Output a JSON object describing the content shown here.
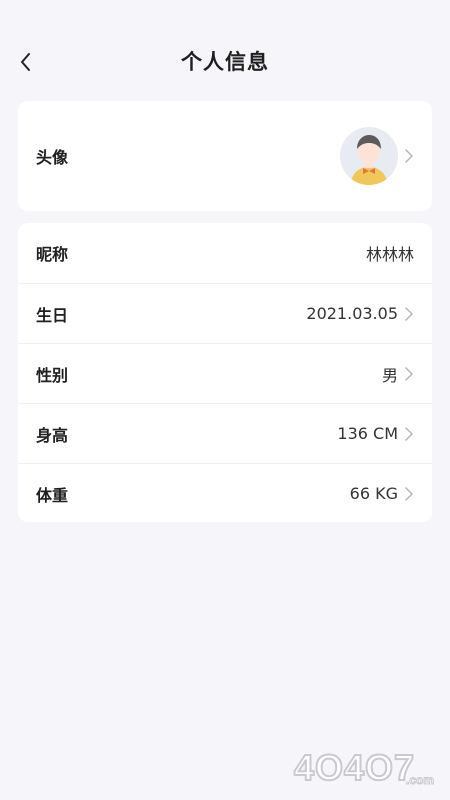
{
  "header": {
    "title": "个人信息",
    "back_icon": "chevron-left-icon"
  },
  "avatar_row": {
    "label": "头像",
    "avatar_icon": "user-avatar-illustration"
  },
  "info_rows": [
    {
      "key": "nickname",
      "label": "昵称",
      "value": "林林林",
      "has_chevron": false
    },
    {
      "key": "birthday",
      "label": "生日",
      "value": "2021.03.05",
      "has_chevron": true
    },
    {
      "key": "gender",
      "label": "性别",
      "value": "男",
      "has_chevron": true
    },
    {
      "key": "height",
      "label": "身高",
      "value": "136 CM",
      "has_chevron": true
    },
    {
      "key": "weight",
      "label": "体重",
      "value": "66 KG",
      "has_chevron": true
    }
  ],
  "watermark": {
    "text": "4O4O7.com"
  },
  "colors": {
    "background": "#f5f5fa",
    "card": "#ffffff",
    "text_primary": "#202020",
    "chevron": "#b5b5bd",
    "avatar_bg": "#e9ebf3",
    "avatar_shirt": "#f0c85a",
    "avatar_hair": "#5b5b5b",
    "avatar_face": "#ffe2d6",
    "avatar_bow": "#e8733a"
  }
}
